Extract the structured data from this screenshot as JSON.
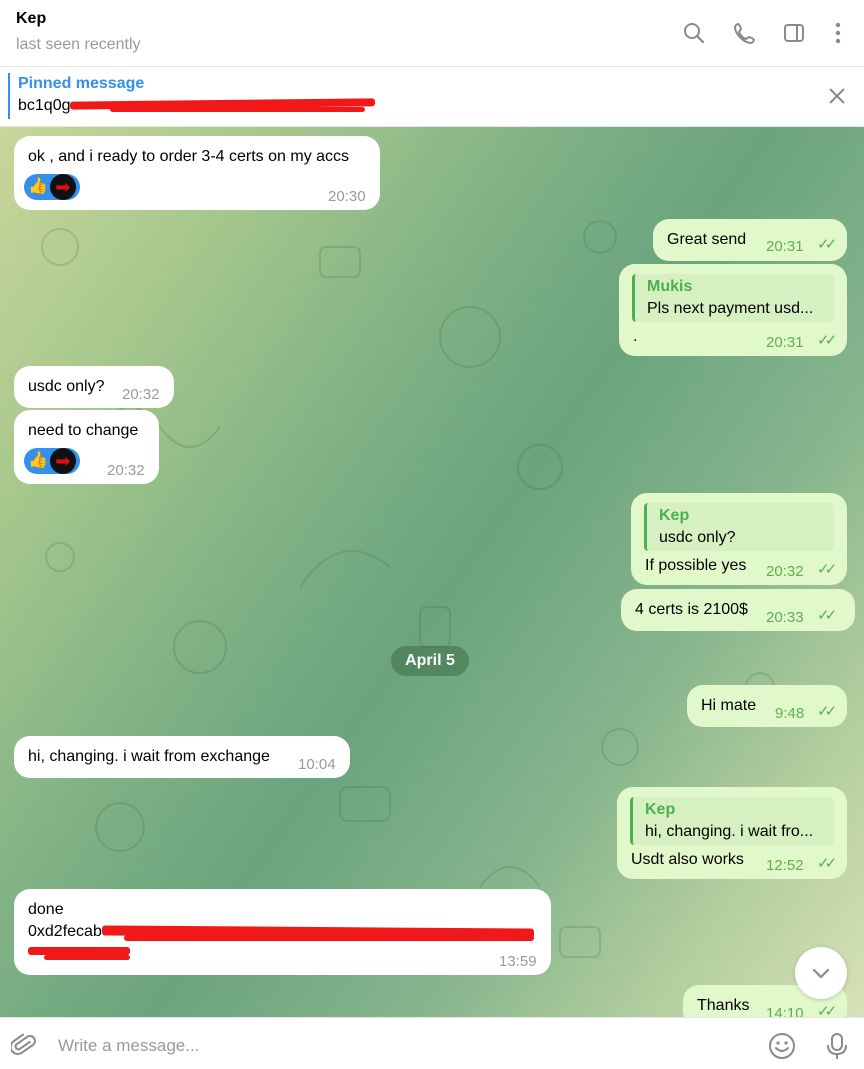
{
  "header": {
    "name": "Kep",
    "status": "last seen recently",
    "icons": [
      "search-icon",
      "phone-icon",
      "sidebar-icon",
      "more-icon"
    ]
  },
  "pinned": {
    "title": "Pinned message",
    "text": "bc1q0g"
  },
  "messages": {
    "m1": {
      "text": "ok , and i ready to order 3-4 certs on my accs",
      "time": "20:30"
    },
    "m2": {
      "text": "Great send",
      "time": "20:31"
    },
    "m3": {
      "reply_name": "Mukis",
      "reply_text": "Pls next payment usd...",
      "text": ".",
      "time": "20:31"
    },
    "m4": {
      "text": "usdc only?",
      "time": "20:32"
    },
    "m5": {
      "text": "need to change",
      "time": "20:32"
    },
    "m6": {
      "reply_name": "Kep",
      "reply_text": "usdc only?",
      "text": "If possible yes",
      "time": "20:32"
    },
    "m7": {
      "text": "4 certs is 2100$",
      "time": "20:33"
    },
    "date": "April 5",
    "m8": {
      "text": "Hi mate",
      "time": "9:48"
    },
    "m9": {
      "text": "hi, changing. i wait from exchange",
      "time": "10:04"
    },
    "m10": {
      "reply_name": "Kep",
      "reply_text": "hi, changing. i wait fro...",
      "text": "Usdt also works",
      "time": "12:52"
    },
    "m11": {
      "text_line1": "done",
      "text_line2": "0xd2fecab",
      "time": "13:59"
    },
    "m12": {
      "text": "Thanks",
      "time": "14:10"
    }
  },
  "reactions": {
    "emoji": "👍"
  },
  "composer": {
    "placeholder": "Write a message..."
  },
  "colors": {
    "accent": "#3390ec",
    "outgoing": "#e1f8cb",
    "incoming": "#ffffff",
    "check": "#5fae4f",
    "redaction": "#f01818"
  }
}
